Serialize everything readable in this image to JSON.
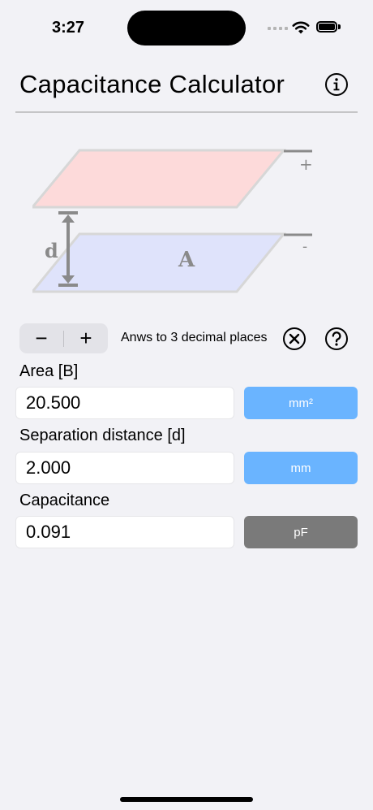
{
  "status_bar": {
    "time": "3:27"
  },
  "header": {
    "title": "Capacitance Calculator",
    "info_icon": "info-circle-icon"
  },
  "diagram": {
    "distance_label": "d",
    "area_label": "A",
    "plus_sign": "+",
    "minus_sign": "-",
    "top_plate_color": "#fddada",
    "bottom_plate_color": "#dfe3fb"
  },
  "precision": {
    "minus_label": "−",
    "plus_label": "+",
    "text": "Anws to 3 decimal places",
    "clear_icon": "clear-circle-icon",
    "help_icon": "question-circle-icon"
  },
  "fields": {
    "area": {
      "label": "Area [B]",
      "value": "20.500",
      "unit": "mm²"
    },
    "distance": {
      "label": "Separation distance [d]",
      "value": "2.000",
      "unit": "mm"
    },
    "capacitance": {
      "label": "Capacitance",
      "value": "0.091",
      "unit": "pF"
    }
  },
  "colors": {
    "unit_blue": "#6ab4ff",
    "unit_gray": "#7a7a7a",
    "background": "#f2f2f6"
  }
}
